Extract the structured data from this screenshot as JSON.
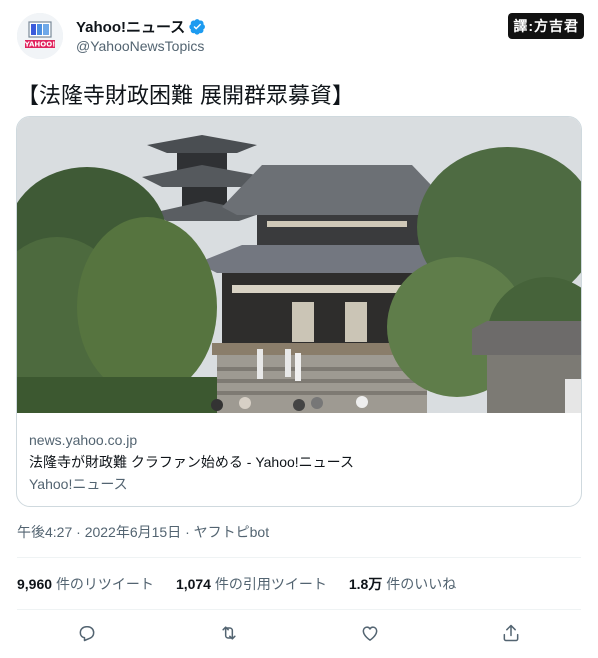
{
  "account": {
    "name": "Yahoo!ニュース",
    "handle": "@YahooNewsTopics",
    "avatar_text": "YAHOO!"
  },
  "badge": "譯:方吉君",
  "tweet": {
    "text": "【法隆寺財政困難 展開群眾募資】"
  },
  "card": {
    "domain": "news.yahoo.co.jp",
    "title": "法隆寺が財政難 クラファン始める - Yahoo!ニュース",
    "source": "Yahoo!ニュース",
    "image_alt": "法隆寺"
  },
  "meta": {
    "timestamp": "午後4:27 · 2022年6月15日 · ヤフトピbot"
  },
  "stats": {
    "retweets_count": "9,960",
    "retweets_label": "件のリツイート",
    "quotes_count": "1,074",
    "quotes_label": "件の引用ツイート",
    "likes_count": "1.8万",
    "likes_label": "件のいいね"
  },
  "icons": {
    "verified": "verified-icon",
    "reply": "reply-icon",
    "retweet": "retweet-icon",
    "like": "heart-icon",
    "share": "share-icon"
  },
  "colors": {
    "verified": "#1d9bf0",
    "secondary_text": "#536471",
    "border": "#cfd9de"
  }
}
